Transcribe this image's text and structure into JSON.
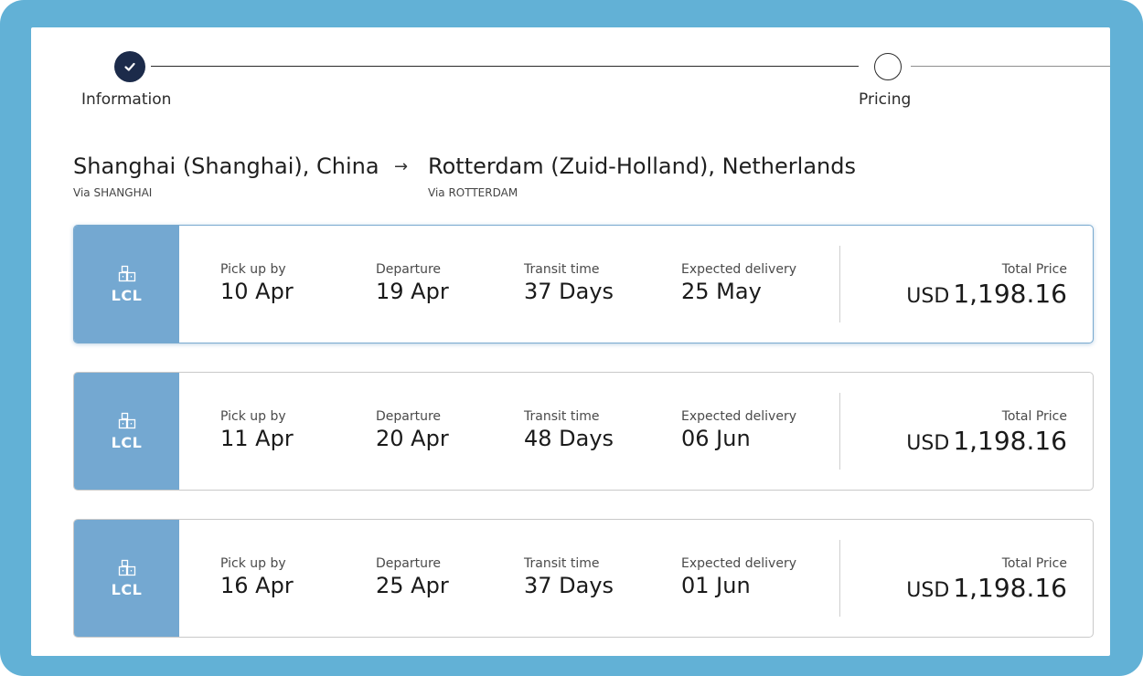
{
  "stepper": {
    "steps": [
      {
        "label": "Information",
        "status": "done"
      },
      {
        "label": "Pricing",
        "status": "todo"
      }
    ]
  },
  "route": {
    "origin": "Shanghai (Shanghai), China",
    "arrow": "→",
    "destination": "Rotterdam (Zuid-Holland), Netherlands",
    "origin_via": "Via SHANGHAI",
    "destination_via": "Via ROTTERDAM"
  },
  "labels": {
    "pickup": "Pick up by",
    "departure": "Departure",
    "transit": "Transit time",
    "delivery": "Expected delivery",
    "total": "Total Price"
  },
  "quotes": [
    {
      "mode": "LCL",
      "pickup": "10 Apr",
      "departure": "19 Apr",
      "transit": "37 Days",
      "delivery": "25 May",
      "currency": "USD",
      "amount": "1,198.16",
      "selected": true
    },
    {
      "mode": "LCL",
      "pickup": "11 Apr",
      "departure": "20 Apr",
      "transit": "48 Days",
      "delivery": "06 Jun",
      "currency": "USD",
      "amount": "1,198.16",
      "selected": false
    },
    {
      "mode": "LCL",
      "pickup": "16 Apr",
      "departure": "25 Apr",
      "transit": "37 Days",
      "delivery": "01 Jun",
      "currency": "USD",
      "amount": "1,198.16",
      "selected": false
    }
  ],
  "colors": {
    "frame": "#62b1d6",
    "mode_bg": "#74a8d1",
    "step_done": "#1c2b4a",
    "selected_border": "#78a9cf"
  },
  "icons": {
    "step_done": "check-icon",
    "mode": "boxes-icon"
  }
}
